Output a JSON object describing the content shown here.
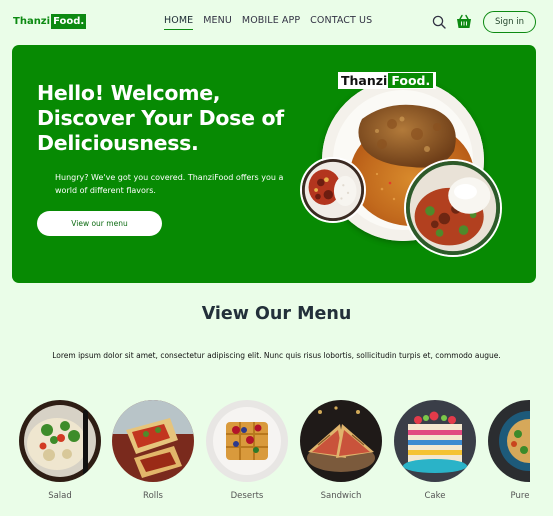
{
  "nav": {
    "logo_part1": "Thanzi",
    "logo_part2": "Food.",
    "links": [
      "HOME",
      "MENU",
      "MOBILE APP",
      "CONTACT US"
    ],
    "active": "HOME",
    "signin_label": "Sign in",
    "icons": [
      "search-icon",
      "cart-icon"
    ]
  },
  "hero": {
    "heading_line1": "Hello! Welcome,",
    "heading_line2": "Discover Your Dose of",
    "heading_line3": "Deliciousness.",
    "subtext": "Hungry? We've got you covered. ThanziFood offers you a world of different flavors.",
    "button_label": "View our menu",
    "brand_part1": "Thanzi",
    "brand_part2": "Food."
  },
  "menu_section": {
    "title": "View Our Menu",
    "description": "Lorem ipsum dolor sit amet, consectetur adipiscing elit. Nunc quis risus lobortis, sollicitudin turpis et, commodo augue.",
    "categories": [
      "Salad",
      "Rolls",
      "Deserts",
      "Sandwich",
      "Cake",
      "Pure"
    ]
  },
  "colors": {
    "brand_green": "#0d8a12",
    "hero_green": "#078a03",
    "background": "#eafde8"
  }
}
